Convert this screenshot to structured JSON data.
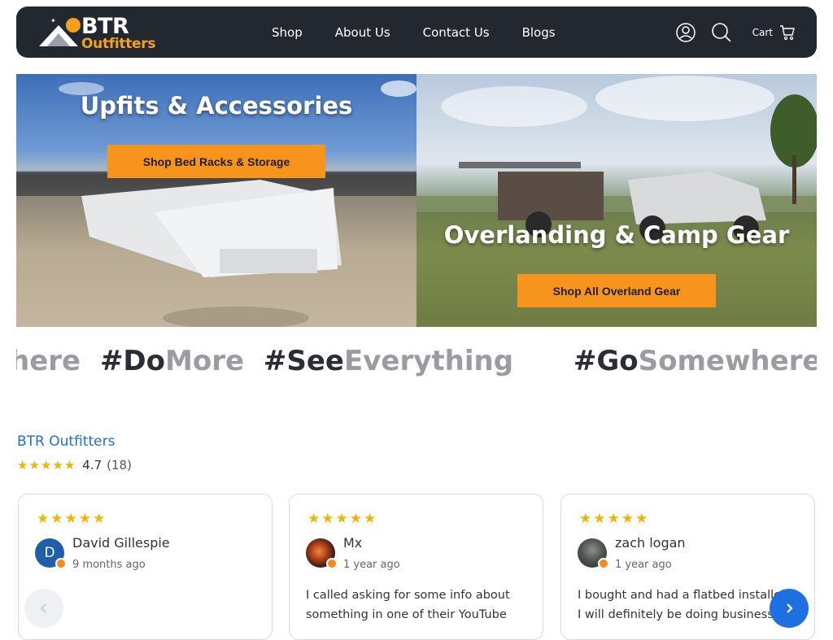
{
  "header": {
    "logo_top": "BTR",
    "logo_bottom": "Outfitters",
    "nav": [
      "Shop",
      "About Us",
      "Contact Us",
      "Blogs"
    ],
    "icons": [
      "account-icon",
      "search-icon",
      "cart-icon"
    ],
    "cart_label": "Cart"
  },
  "hero": {
    "left": {
      "title": "Upfits & Accessories",
      "button": "Shop Bed Racks & Storage"
    },
    "right": {
      "title": "Overlanding & Camp Gear",
      "button": "Shop All Overland Gear"
    }
  },
  "marquee": [
    {
      "dark": "",
      "light": "here"
    },
    {
      "dark": "#Do",
      "light": "More"
    },
    {
      "dark": "#See",
      "light": "Everything"
    },
    {
      "dark": "#Go",
      "light": "Somewhere"
    },
    {
      "dark": "#",
      "light": ""
    }
  ],
  "reviews": {
    "brand": "BTR Outfitters",
    "rating": "4.7",
    "count": "(18)",
    "items": [
      {
        "initial": "D",
        "name": "David Gillespie",
        "date": "9 months ago",
        "stars": 5,
        "text": ""
      },
      {
        "initial": "",
        "name": "Mx",
        "date": "1 year ago",
        "stars": 5,
        "text": "I called asking for some info about something in one of their YouTube"
      },
      {
        "initial": "",
        "name": "zach logan",
        "date": "1 year ago",
        "stars": 5,
        "text": "I bought and had a flatbed installed. I will definitely be doing business"
      }
    ]
  },
  "colors": {
    "header_bg": "#232830",
    "accent": "#f7941d",
    "brand_blue": "#1e6fd0",
    "star": "#f5b301"
  }
}
